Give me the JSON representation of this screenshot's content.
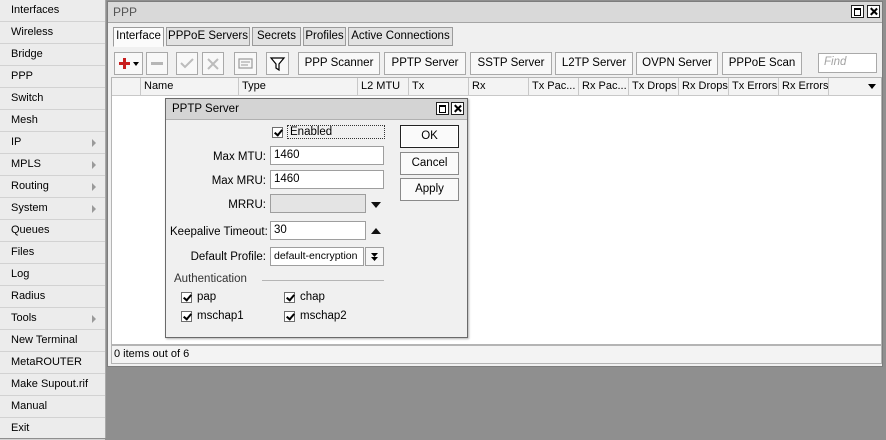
{
  "sidebar": {
    "items": [
      {
        "label": "Interfaces",
        "submenu": false
      },
      {
        "label": "Wireless",
        "submenu": false
      },
      {
        "label": "Bridge",
        "submenu": false
      },
      {
        "label": "PPP",
        "submenu": false
      },
      {
        "label": "Switch",
        "submenu": false
      },
      {
        "label": "Mesh",
        "submenu": false
      },
      {
        "label": "IP",
        "submenu": true
      },
      {
        "label": "MPLS",
        "submenu": true
      },
      {
        "label": "Routing",
        "submenu": true
      },
      {
        "label": "System",
        "submenu": true
      },
      {
        "label": "Queues",
        "submenu": false
      },
      {
        "label": "Files",
        "submenu": false
      },
      {
        "label": "Log",
        "submenu": false
      },
      {
        "label": "Radius",
        "submenu": false
      },
      {
        "label": "Tools",
        "submenu": true
      },
      {
        "label": "New Terminal",
        "submenu": false
      },
      {
        "label": "MetaROUTER",
        "submenu": false
      },
      {
        "label": "Make Supout.rif",
        "submenu": false
      },
      {
        "label": "Manual",
        "submenu": false
      },
      {
        "label": "Exit",
        "submenu": false
      }
    ]
  },
  "window": {
    "title": "PPP",
    "tabs": [
      "Interface",
      "PPPoE Servers",
      "Secrets",
      "Profiles",
      "Active Connections"
    ],
    "active_tab": 0,
    "toolbar": {
      "icons": [
        "add-icon",
        "remove-icon",
        "enable-icon",
        "disable-icon",
        "comment-icon",
        "filter-icon"
      ],
      "buttons": [
        "PPP Scanner",
        "PPTP Server",
        "SSTP Server",
        "L2TP Server",
        "OVPN Server",
        "PPPoE Scan"
      ],
      "find_placeholder": "Find"
    },
    "table": {
      "columns": [
        "Name",
        "Type",
        "L2 MTU",
        "Tx",
        "Rx",
        "Tx Pac...",
        "Rx Pac...",
        "Tx Drops",
        "Rx Drops",
        "Tx Errors",
        "Rx Errors"
      ],
      "rows": []
    },
    "status": "0 items out of 6"
  },
  "dialog": {
    "title": "PPTP Server",
    "enabled_label": "Enabled",
    "enabled": true,
    "max_mtu_label": "Max MTU:",
    "max_mtu": "1460",
    "max_mru_label": "Max MRU:",
    "max_mru": "1460",
    "mrru_label": "MRRU:",
    "mrru": "",
    "keepalive_label": "Keepalive Timeout:",
    "keepalive": "30",
    "profile_label": "Default Profile:",
    "profile": "default-encryption",
    "auth_section": "Authentication",
    "auth": [
      {
        "label": "pap",
        "checked": true
      },
      {
        "label": "chap",
        "checked": true
      },
      {
        "label": "mschap1",
        "checked": true
      },
      {
        "label": "mschap2",
        "checked": true
      }
    ],
    "ok_label": "OK",
    "cancel_label": "Cancel",
    "apply_label": "Apply"
  },
  "colors": {
    "sidebar_bg": "#ececec",
    "desktop_bg": "#8f8f8f",
    "add_icon_red": "#c81e1e"
  }
}
